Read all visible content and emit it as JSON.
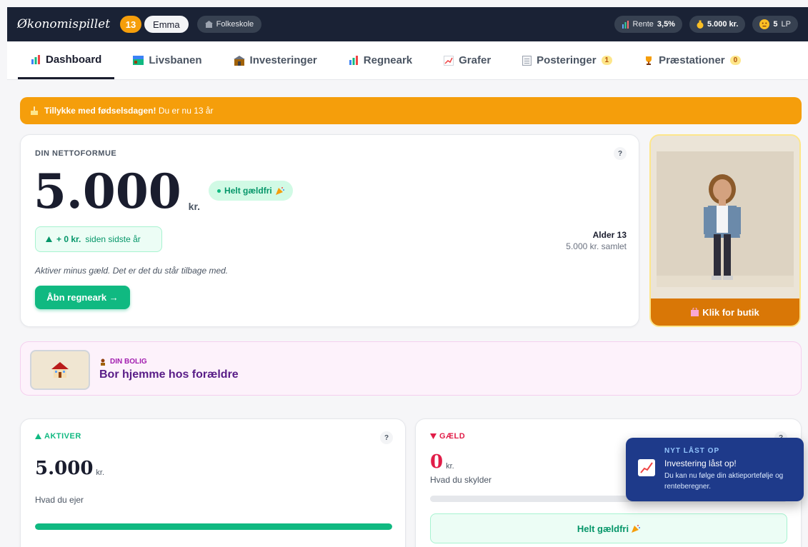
{
  "topbar": {
    "logo": "Økonomispillet",
    "age": "13",
    "name": "Emma",
    "school": "Folkeskole",
    "rente_label": "Rente",
    "rente_value": "3,5%",
    "money": "5.000 kr.",
    "lp_value": "5",
    "lp_unit": "LP"
  },
  "tabs": [
    {
      "label": "Dashboard",
      "icon": "bar-chart-icon",
      "badge": ""
    },
    {
      "label": "Livsbanen",
      "icon": "map-icon",
      "badge": ""
    },
    {
      "label": "Investeringer",
      "icon": "bank-icon",
      "badge": ""
    },
    {
      "label": "Regneark",
      "icon": "bar-chart-icon",
      "badge": ""
    },
    {
      "label": "Grafer",
      "icon": "line-chart-icon",
      "badge": ""
    },
    {
      "label": "Posteringer",
      "icon": "ledger-icon",
      "badge": "1"
    },
    {
      "label": "Præstationer",
      "icon": "trophy-icon",
      "badge": "0"
    }
  ],
  "birthday": {
    "bold": "Tillykke med fødselsdagen!",
    "text": "Du er nu 13 år"
  },
  "networth": {
    "label": "DIN NETTOFORMUE",
    "value": "5.000",
    "unit": "kr.",
    "debtfree": "Helt gældfri",
    "change_value": "+ 0 kr.",
    "change_text": "siden sidste år",
    "age_text": "Alder 13",
    "total_text": "5.000 kr. samlet",
    "description": "Aktiver minus gæld. Det er det du står tilbage med.",
    "button": "Åbn regneark →"
  },
  "avatar": {
    "shop": "Klik for butik"
  },
  "housing": {
    "label": "DIN BOLIG",
    "title": "Bor hjemme hos forældre"
  },
  "assets": {
    "label": "AKTIVER",
    "value": "5.000",
    "unit": "kr.",
    "desc": "Hvad du ejer",
    "fill": 1.0
  },
  "debt": {
    "label": "GÆLD",
    "value": "0",
    "unit": "kr.",
    "desc": "Hvad du skylder",
    "fill": 0.0,
    "status": "Helt gældfri"
  },
  "toast": {
    "header": "NYT LÅST OP",
    "title": "Investering låst op!",
    "body": "Du kan nu følge din aktieportefølje og renteberegner."
  },
  "colors": {
    "navy": "#1a2235",
    "orange": "#f59e0b",
    "green": "#10b981",
    "red": "#e11d48",
    "purple": "#581c87"
  }
}
